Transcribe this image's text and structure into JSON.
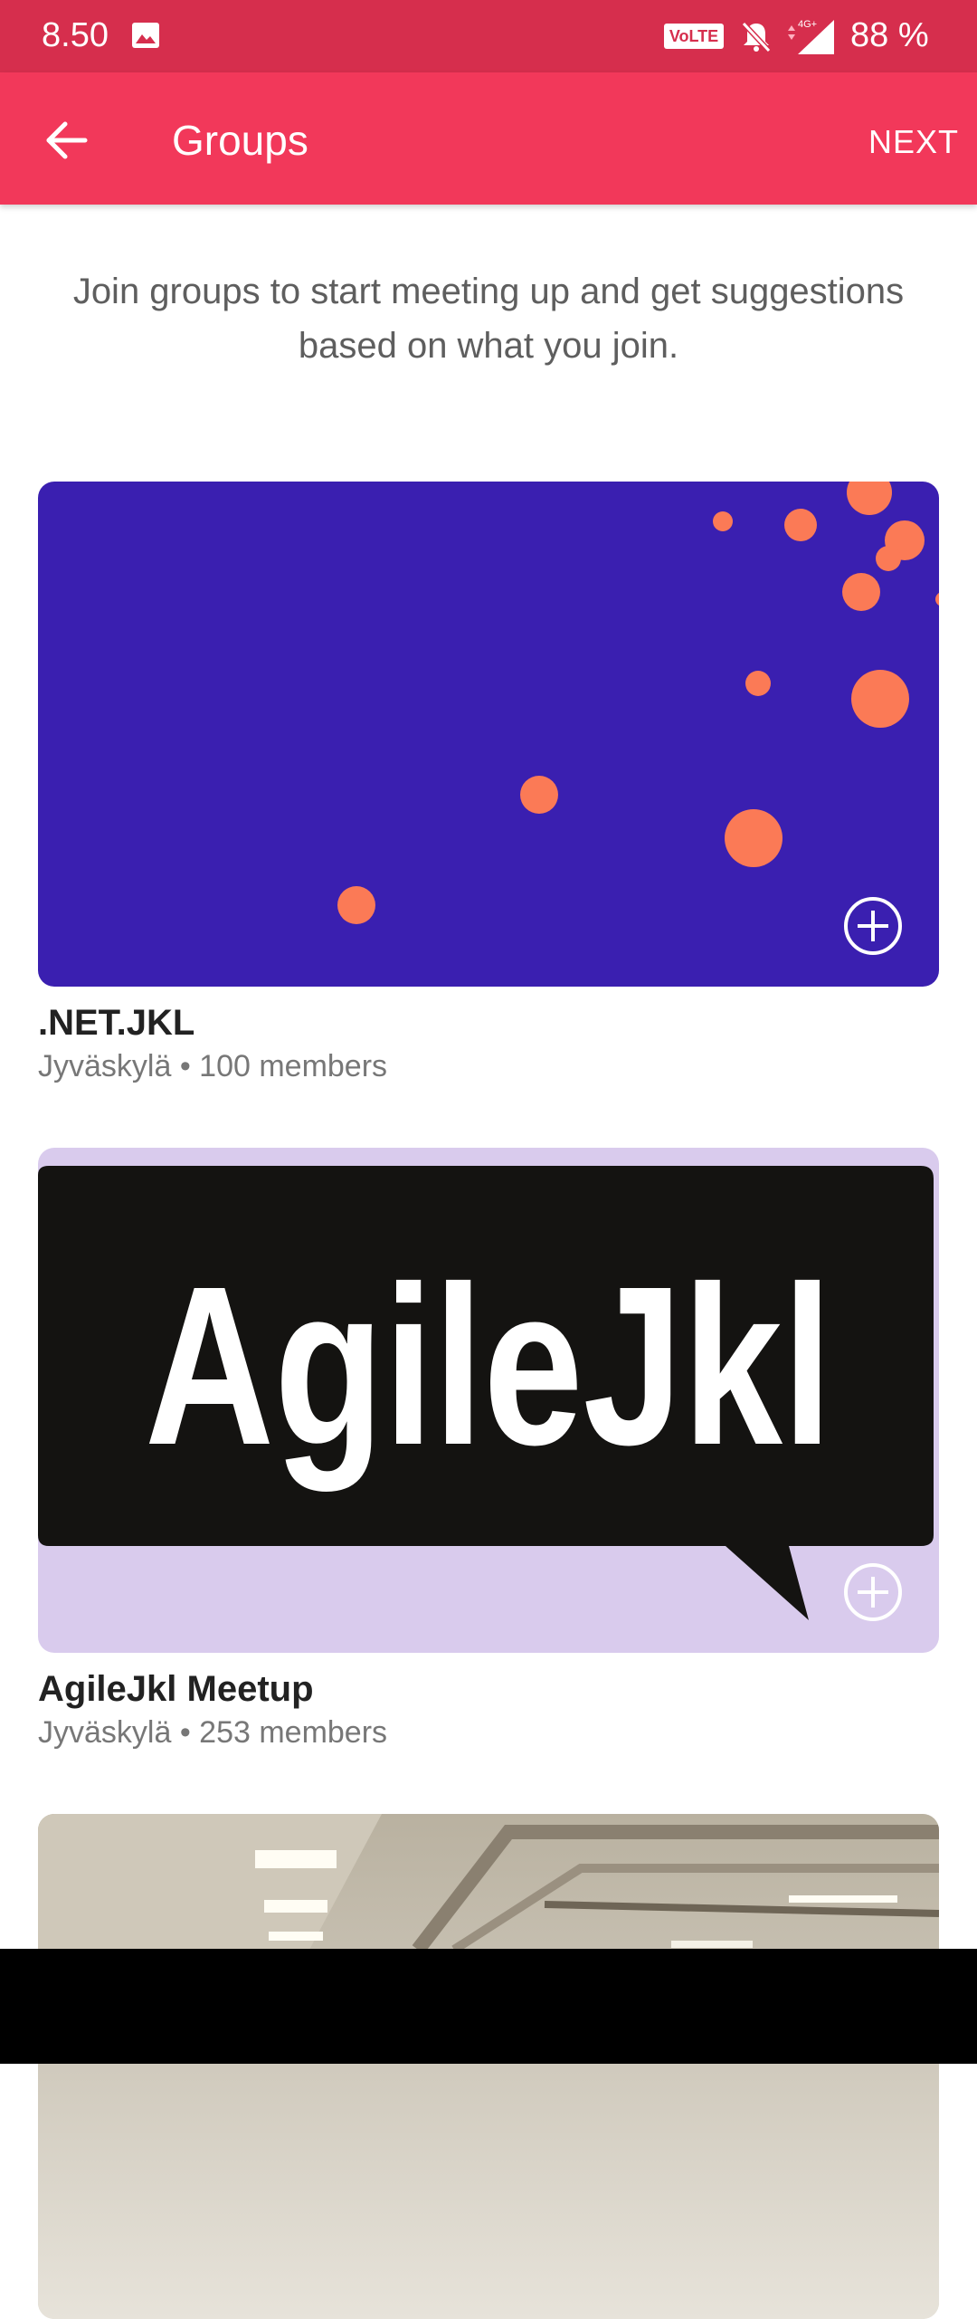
{
  "status_bar": {
    "time": "8.50",
    "volte": "VoLTE",
    "battery": "88 %"
  },
  "app_bar": {
    "title": "Groups",
    "next_label": "NEXT"
  },
  "intro_text": "Join groups to start meeting up and get suggestions based on what you join.",
  "groups": [
    {
      "name": ".NET.JKL",
      "meta": "Jyväskylä • 100 members"
    },
    {
      "name": "AgileJkl Meetup",
      "meta": "Jyväskylä • 253 members",
      "logo_text": "AgileJkl"
    },
    {
      "name": "",
      "meta": ""
    }
  ],
  "colors": {
    "status_bar": "#d62e4d",
    "app_bar": "#f2385a",
    "net_jkl_bg": "#3a1fb0",
    "net_jkl_dots": "#fb7a56",
    "agile_bg": "#d9cbed"
  }
}
